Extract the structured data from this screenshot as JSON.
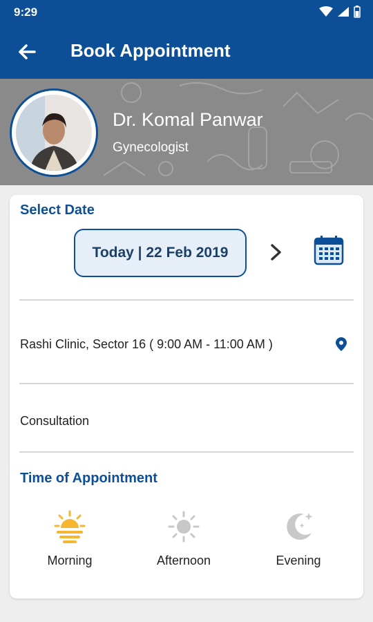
{
  "status_bar": {
    "time": "9:29"
  },
  "app_bar": {
    "title": "Book Appointment",
    "back_icon": "arrow-left-icon"
  },
  "doctor": {
    "name": "Dr. Komal Panwar",
    "specialty": "Gynecologist"
  },
  "select_date": {
    "heading": "Select Date",
    "current_date": "Today | 22 Feb 2019",
    "next_icon": "chevron-right-icon",
    "calendar_icon": "calendar-icon"
  },
  "clinic": {
    "text": "Rashi Clinic, Sector 16 ( 9:00 AM - 11:00 AM )",
    "icon": "location-pin-icon"
  },
  "consultation": {
    "text": "Consultation"
  },
  "time_of_appointment": {
    "heading": "Time of Appointment",
    "slots": [
      {
        "label": "Morning",
        "icon": "sunrise-icon",
        "selected": true
      },
      {
        "label": "Afternoon",
        "icon": "sun-icon",
        "selected": false
      },
      {
        "label": "Evening",
        "icon": "moon-icon",
        "selected": false
      }
    ]
  },
  "colors": {
    "primary": "#0d4f96",
    "accent": "#f5b631",
    "inactive": "#c8c8c8"
  }
}
